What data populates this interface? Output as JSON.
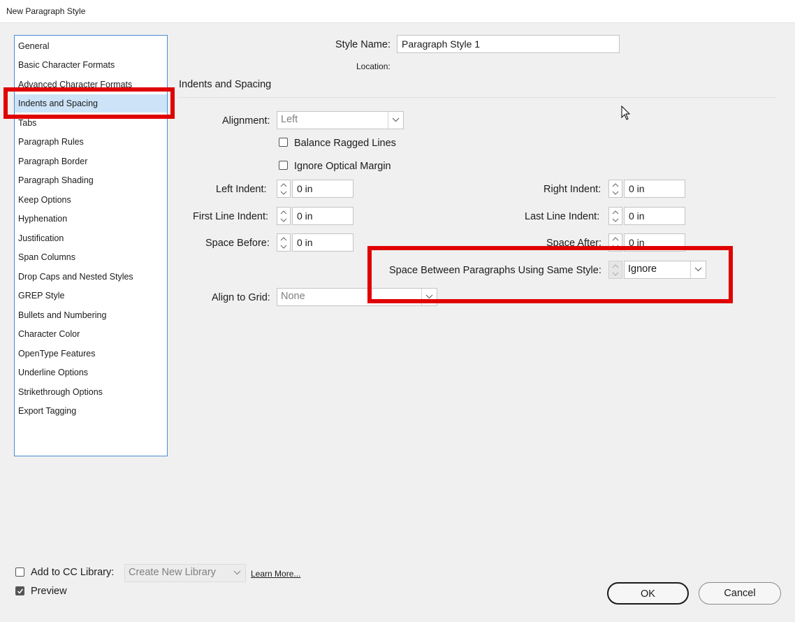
{
  "window": {
    "title": "New Paragraph Style"
  },
  "sidebar": {
    "items": [
      {
        "label": "General"
      },
      {
        "label": "Basic Character Formats"
      },
      {
        "label": "Advanced Character Formats"
      },
      {
        "label": "Indents and Spacing",
        "selected": true
      },
      {
        "label": "Tabs"
      },
      {
        "label": "Paragraph Rules"
      },
      {
        "label": "Paragraph Border"
      },
      {
        "label": "Paragraph Shading"
      },
      {
        "label": "Keep Options"
      },
      {
        "label": "Hyphenation"
      },
      {
        "label": "Justification"
      },
      {
        "label": "Span Columns"
      },
      {
        "label": "Drop Caps and Nested Styles"
      },
      {
        "label": "GREP Style"
      },
      {
        "label": "Bullets and Numbering"
      },
      {
        "label": "Character Color"
      },
      {
        "label": "OpenType Features"
      },
      {
        "label": "Underline Options"
      },
      {
        "label": "Strikethrough Options"
      },
      {
        "label": "Export Tagging"
      }
    ]
  },
  "header": {
    "style_name_label": "Style Name:",
    "style_name_value": "Paragraph Style 1",
    "location_label": "Location:"
  },
  "section": {
    "title": "Indents and Spacing"
  },
  "fields": {
    "alignment_label": "Alignment:",
    "alignment_value": "Left",
    "balance_ragged_lines": "Balance Ragged Lines",
    "ignore_optical_margin": "Ignore Optical Margin",
    "left_indent_label": "Left Indent:",
    "left_indent_value": "0 in",
    "right_indent_label": "Right Indent:",
    "right_indent_value": "0 in",
    "first_line_indent_label": "First Line Indent:",
    "first_line_indent_value": "0 in",
    "last_line_indent_label": "Last Line Indent:",
    "last_line_indent_value": "0 in",
    "space_before_label": "Space Before:",
    "space_before_value": "0 in",
    "space_after_label": "Space After:",
    "space_after_value": "0 in",
    "space_between_label": "Space Between Paragraphs Using Same Style:",
    "space_between_value": "Ignore",
    "align_to_grid_label": "Align to Grid:",
    "align_to_grid_value": "None"
  },
  "footer": {
    "add_to_cc_library_label": "Add to CC Library:",
    "library_dropdown_value": "Create New Library",
    "learn_more": "Learn More...",
    "preview_label": "Preview",
    "ok_button": "OK",
    "cancel_button": "Cancel"
  },
  "colors": {
    "highlight_border": "#e00000",
    "selected_item_bg": "#cde3f7",
    "list_border": "#4a8ad4"
  }
}
